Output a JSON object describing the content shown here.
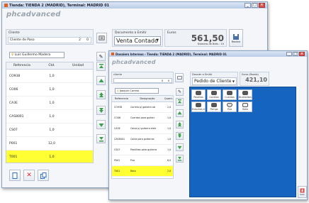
{
  "window1": {
    "title": "Tienda: TIENDA 2 (MADRID), Terminal: MADRID 01",
    "logo": "phcadvanced",
    "client_label": "Cliente",
    "client_value": "Cliente de Paso",
    "client_n1": "2",
    "client_n2": "0",
    "doc_label": "Documento a Emitir",
    "doc_value": "Venta Contado Ma",
    "total_label": "Euros",
    "total_value": "561,50",
    "ticket_label": "Número de Bets : 10",
    "save_label": "Recibir",
    "seller": "Luis Guillermo Madera",
    "columns": [
      "Referencia",
      "Ctd.",
      "Unidad"
    ],
    "rows": [
      {
        "ref": "CO938",
        "qty": "1,0"
      },
      {
        "ref": "CO06",
        "qty": "1,0"
      },
      {
        "ref": "CA3E",
        "qty": "1,0"
      },
      {
        "ref": "CAS8001",
        "qty": "1,0"
      },
      {
        "ref": "CS07",
        "qty": "1,0"
      },
      {
        "ref": "P001",
        "qty": "12,0"
      },
      {
        "ref": "T001",
        "qty": "1,0"
      }
    ]
  },
  "window2": {
    "title": "Dossiers Internos - Tienda: TIENDA 2 (MADRID), Terminal: MADRID 01",
    "logo": "phcadvanced",
    "client_label": "cliente",
    "client_n1": "0",
    "client_n2": "0",
    "doc_label": "Dossier a Emitir",
    "doc_value": "Pedido de Cliente",
    "total_label": "Euros (Moeda)",
    "total_value": "421,10",
    "seller": "Joaquin Correia",
    "columns": [
      "Referencia",
      "Designação",
      "Quant."
    ],
    "rows": [
      {
        "ref": "CO938",
        "desig": "Correia p/ gaiteira ob",
        "qty": "2,0"
      },
      {
        "ref": "CO06",
        "desig": "Cuerdas para guitarr",
        "qty": "1,0"
      },
      {
        "ref": "CA3E",
        "desig": "Caixa p/ guitarra eletr",
        "qty": "1,0"
      },
      {
        "ref": "CAS8001",
        "desig": "Caixa para guitarras",
        "qty": "1,0"
      },
      {
        "ref": "CS07",
        "desig": "Pastilhas para guitarra",
        "qty": "1,0"
      },
      {
        "ref": "P001",
        "desig": "Pua",
        "qty": "6,0"
      },
      {
        "ref": "T001",
        "desig": "Bata",
        "qty": "2,0"
      }
    ],
    "tiles": [
      "Pastillas",
      "Correias",
      "Cuerdas",
      "Bromelitas",
      "Estuches e",
      "Pomgs",
      "Pua",
      "Bata"
    ],
    "exit_label": "Salir"
  },
  "colors": {
    "selected_row": "#ffff33",
    "category_panel": "#1565c0",
    "accent_green": "#3aa04a"
  }
}
